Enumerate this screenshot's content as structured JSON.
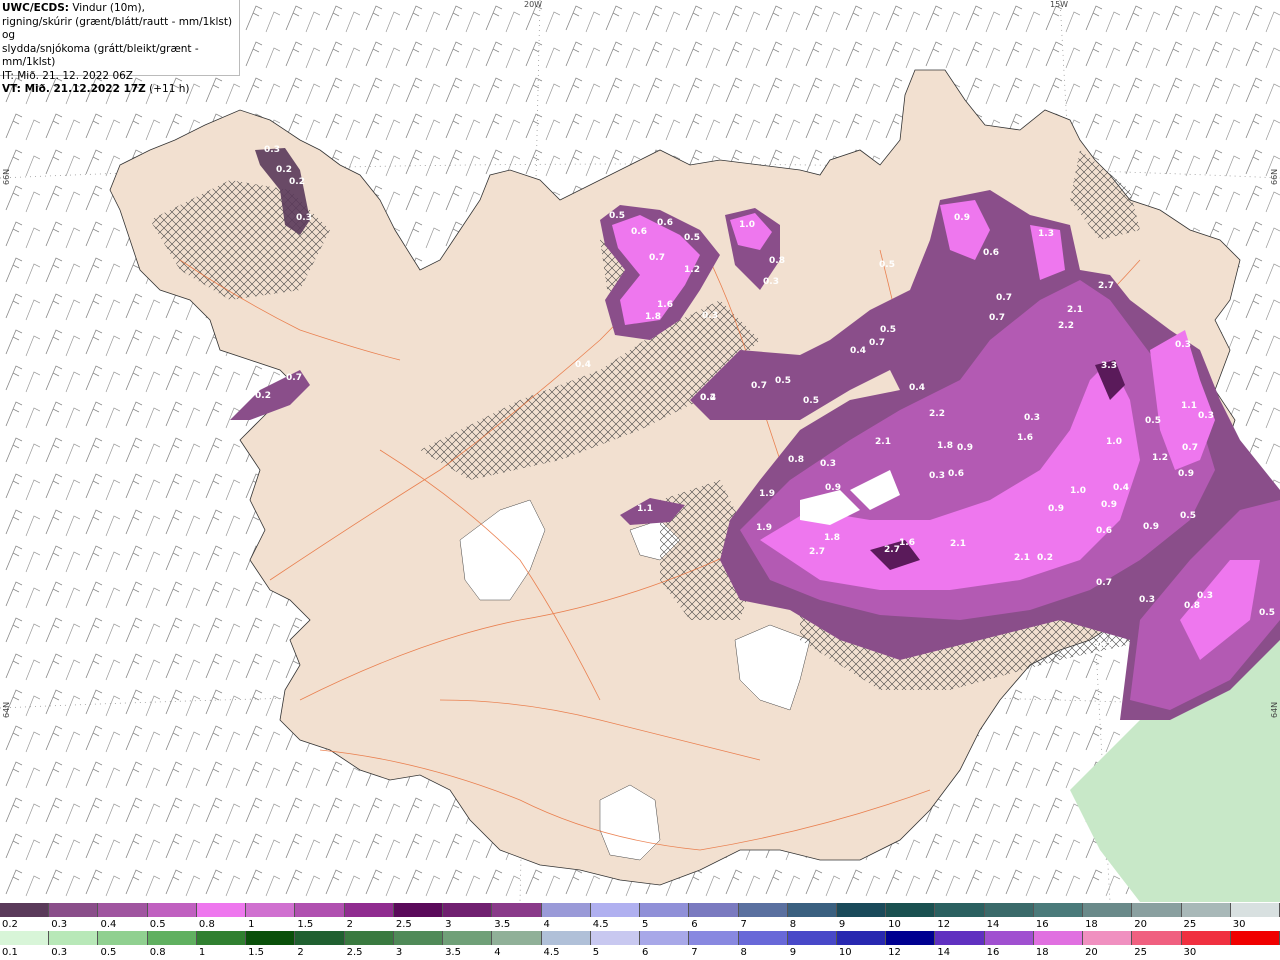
{
  "header": {
    "model": "UWC/ECDS:",
    "line1_rest": " Vindur (10m),",
    "line2": "rigning/skúrir (grænt/blátt/rautt - mm/1klst) og",
    "line3": "slydda/snjókoma (grátt/bleikt/grænt - mm/1klst)",
    "line4": "IT: Mið. 21. 12. 2022 06Z",
    "valid_prefix": "VT: Mið. 21.12.2022 17Z",
    "valid_suffix": " (+11 h)"
  },
  "grid_labels": {
    "lon_20w": "20W",
    "lon_15w": "15W",
    "lat_66n_left": "66N",
    "lat_66n_right": "66N",
    "lat_64n_left": "64N",
    "lat_64n_right": "64N"
  },
  "colors": {
    "land": "#f2e0d0",
    "roads": "#e8703a",
    "glacier": "#ffffff",
    "snow_light": "#8a4e8a",
    "snow_mid": "#b35ab3",
    "snow_high": "#ee77ee",
    "snow_peak": "#5a1a5a",
    "rain_light": "#c8e8c8"
  },
  "precip_labels": [
    {
      "text": "0.3"
    },
    {
      "text": "0.2"
    },
    {
      "text": "0.2"
    },
    {
      "text": "0.3"
    },
    {
      "text": "0.5"
    },
    {
      "text": "0.6"
    },
    {
      "text": "0.6"
    },
    {
      "text": "0.5"
    },
    {
      "text": "1.0"
    },
    {
      "text": "0.7"
    },
    {
      "text": "1.2"
    },
    {
      "text": "0.8"
    },
    {
      "text": "0.3"
    },
    {
      "text": "1.6"
    },
    {
      "text": "1.8"
    },
    {
      "text": "0.3"
    },
    {
      "text": "0.9"
    },
    {
      "text": "1.3"
    },
    {
      "text": "0.6"
    },
    {
      "text": "0.5"
    },
    {
      "text": "0.7"
    },
    {
      "text": "0.7"
    },
    {
      "text": "2.7"
    },
    {
      "text": "2.1"
    },
    {
      "text": "2.2"
    },
    {
      "text": "0.5"
    },
    {
      "text": "0.7"
    },
    {
      "text": "0.4"
    },
    {
      "text": "3.3"
    },
    {
      "text": "0.7"
    },
    {
      "text": "0.5"
    },
    {
      "text": "0.4"
    },
    {
      "text": "0.5"
    },
    {
      "text": "0.4"
    },
    {
      "text": "0.3"
    },
    {
      "text": "1.1"
    },
    {
      "text": "0.3"
    },
    {
      "text": "0.3"
    },
    {
      "text": "2.2"
    },
    {
      "text": "1.6"
    },
    {
      "text": "2.1"
    },
    {
      "text": "1.8"
    },
    {
      "text": "0.9"
    },
    {
      "text": "1.0"
    },
    {
      "text": "0.5"
    },
    {
      "text": "0.7"
    },
    {
      "text": "0.8"
    },
    {
      "text": "0.3"
    },
    {
      "text": "0.3"
    },
    {
      "text": "0.6"
    },
    {
      "text": "1.2"
    },
    {
      "text": "0.9"
    },
    {
      "text": "1.0"
    },
    {
      "text": "0.4"
    },
    {
      "text": "0.9"
    },
    {
      "text": "1.9"
    },
    {
      "text": "0.9"
    },
    {
      "text": "0.9"
    },
    {
      "text": "0.5"
    },
    {
      "text": "0.9"
    },
    {
      "text": "0.6"
    },
    {
      "text": "1.1"
    },
    {
      "text": "1.9"
    },
    {
      "text": "1.8"
    },
    {
      "text": "2.7"
    },
    {
      "text": "2.7"
    },
    {
      "text": "1.6"
    },
    {
      "text": "2.1"
    },
    {
      "text": "2.1"
    },
    {
      "text": "0.2"
    },
    {
      "text": "0.7"
    },
    {
      "text": "0.8"
    },
    {
      "text": "0.3"
    },
    {
      "text": "0.3"
    },
    {
      "text": "0.5"
    },
    {
      "text": "0.7"
    },
    {
      "text": "0.2"
    },
    {
      "text": "0.2"
    },
    {
      "text": "0.4"
    },
    {
      "text": "0.2"
    }
  ],
  "legend_snow": {
    "labels": [
      "0.2",
      "0.3",
      "0.4",
      "0.5",
      "0.8",
      "1",
      "1.5",
      "2",
      "2.5",
      "3",
      "3.5",
      "4",
      "4.5",
      "5",
      "6",
      "7",
      "8",
      "9",
      "10",
      "12",
      "14",
      "16",
      "18",
      "20",
      "25",
      "30"
    ],
    "colors": [
      "#5a3a5a",
      "#8a4e8a",
      "#a055a0",
      "#c060c0",
      "#ee77ee",
      "#d070d0",
      "#b050b0",
      "#902c90",
      "#5a0a5a",
      "#702070",
      "#8a3a8a",
      "#9a9ad8",
      "#b0b0f0",
      "#9090d8",
      "#7a7ac0",
      "#5a70a0",
      "#3a6080",
      "#1a4a5a",
      "#1a5050",
      "#2a6060",
      "#3a6a6a",
      "#4a7a7a",
      "#6a8a8a",
      "#8aa0a0",
      "#a8b8b8",
      "#d8e0e0"
    ]
  },
  "legend_rain": {
    "labels": [
      "0.1",
      "0.3",
      "0.5",
      "0.8",
      "1",
      "1.5",
      "2",
      "2.5",
      "3",
      "3.5",
      "4",
      "4.5",
      "5",
      "6",
      "7",
      "8",
      "9",
      "10",
      "12",
      "14",
      "16",
      "18",
      "20",
      "25",
      "30"
    ],
    "colors": [
      "#d8f5d8",
      "#b8e8b8",
      "#90d090",
      "#60b060",
      "#308030",
      "#0a500a",
      "#206030",
      "#3a7a40",
      "#508a58",
      "#70a078",
      "#90b098",
      "#b0c0d8",
      "#c8c8f0",
      "#a8a8e8",
      "#8888e0",
      "#6868d8",
      "#4848c8",
      "#2828b0",
      "#000090",
      "#6030c0",
      "#a050d0",
      "#e070e0",
      "#f090c0",
      "#f06080",
      "#f03040",
      "#f00000"
    ]
  }
}
